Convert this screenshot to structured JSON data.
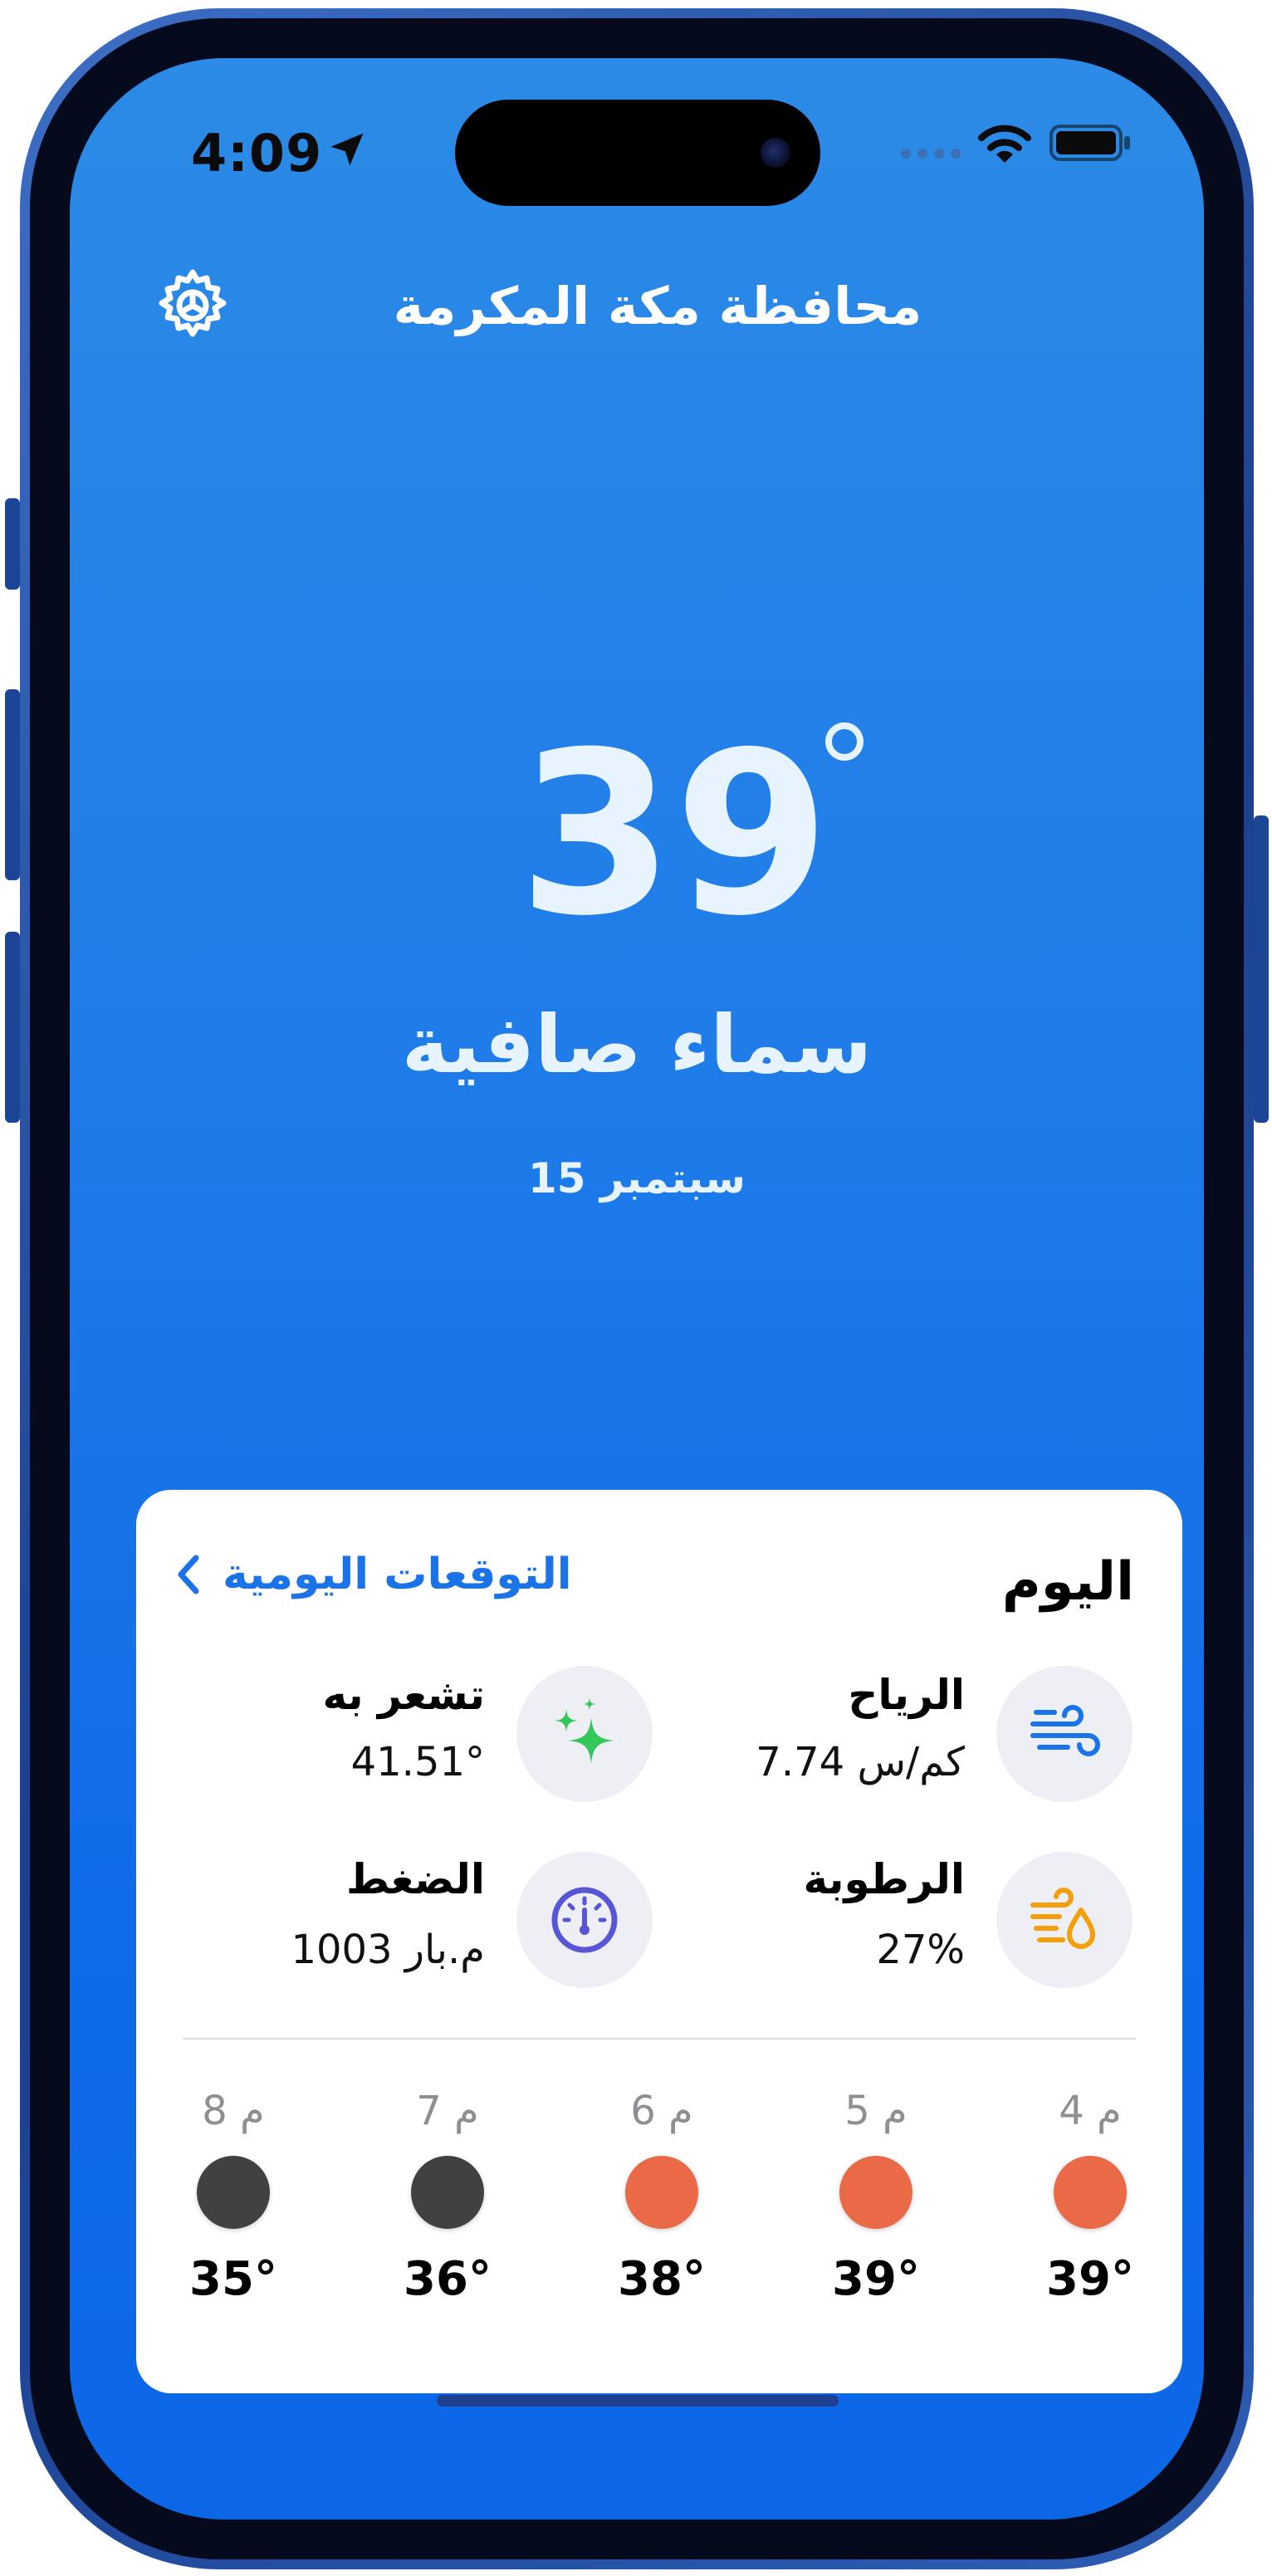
{
  "status_bar": {
    "time": "4:09"
  },
  "header": {
    "city": "محافظة مكة المكرمة"
  },
  "current": {
    "temperature": "39",
    "condition": "سماء صافية",
    "date": "15 سبتمبر"
  },
  "card": {
    "title": "اليوم",
    "daily_link": "التوقعات اليومية",
    "stats": {
      "wind": {
        "label": "الرياح",
        "value": "7.74 كم/س",
        "icon": "wind-icon"
      },
      "feels_like": {
        "label": "تشعر به",
        "value": "41.51°",
        "icon": "sparkles-icon"
      },
      "humidity": {
        "label": "الرطوبة",
        "value": "27%",
        "icon": "humidity-icon"
      },
      "pressure": {
        "label": "الضغط",
        "value": "1003 م.بار",
        "icon": "gauge-icon"
      }
    },
    "hourly": [
      {
        "time": "4 م",
        "temp": "39°",
        "color": "#ea6a48"
      },
      {
        "time": "5 م",
        "temp": "39°",
        "color": "#ea6a48"
      },
      {
        "time": "6 م",
        "temp": "38°",
        "color": "#ea6a48"
      },
      {
        "time": "7 م",
        "temp": "36°",
        "color": "#414141"
      },
      {
        "time": "8 م",
        "temp": "35°",
        "color": "#414141"
      }
    ]
  },
  "colors": {
    "accent": "#1a73e8",
    "wind_icon": "#1a73e8",
    "feels_like_icon": "#34c759",
    "humidity_icon": "#f59e0b",
    "pressure_icon": "#5856d6"
  }
}
